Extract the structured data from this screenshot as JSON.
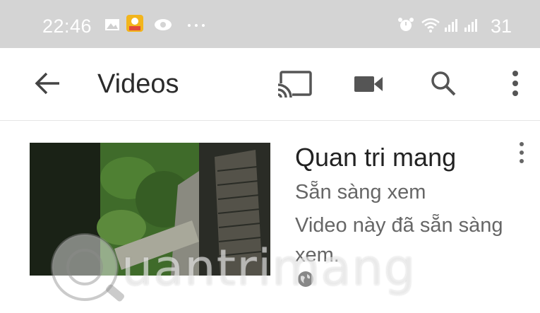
{
  "status_bar": {
    "time": "22:46",
    "battery": "31",
    "icons": [
      "gallery-icon",
      "app-notification-icon",
      "eye-icon",
      "more-dots-icon",
      "alarm-icon",
      "wifi-icon",
      "signal-icon",
      "signal-icon"
    ]
  },
  "app_bar": {
    "title": "Videos",
    "icons": [
      "back-arrow-icon",
      "cast-icon",
      "video-camera-icon",
      "search-icon",
      "more-vert-icon"
    ]
  },
  "video": {
    "title": "Quan tri mang",
    "status": "Sẵn sàng xem",
    "description": "Video này đã sẵn sàng xem.",
    "privacy_icon": "globe-icon"
  },
  "watermark": {
    "text": "uantrimang"
  },
  "colors": {
    "status_bar": "#d4d4d4",
    "title_text": "#222222",
    "secondary_text": "#666666"
  }
}
